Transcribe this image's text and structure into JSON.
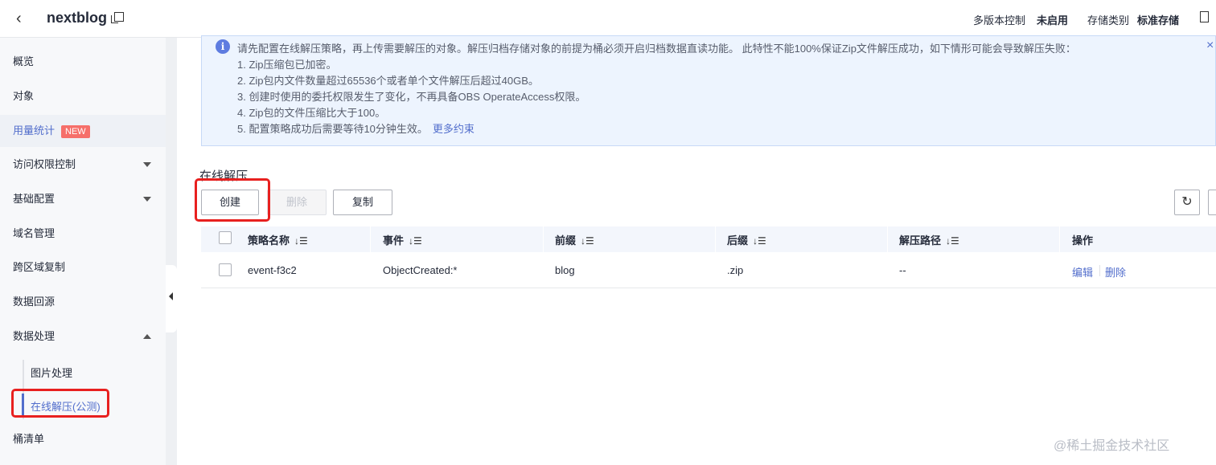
{
  "header": {
    "back_icon": "chevron-left-icon",
    "bucket_name": "nextblog",
    "versioning_label": "多版本控制",
    "versioning_value": "未启用",
    "storage_class_label": "存储类别",
    "storage_class_value": "标准存储"
  },
  "sidebar": {
    "items": [
      {
        "label": "概览"
      },
      {
        "label": "对象"
      },
      {
        "label": "用量统计",
        "badge": "NEW"
      },
      {
        "label": "访问权限控制"
      },
      {
        "label": "基础配置"
      },
      {
        "label": "域名管理"
      },
      {
        "label": "跨区域复制"
      },
      {
        "label": "数据回源"
      },
      {
        "label": "数据处理"
      },
      {
        "label": "桶清单"
      }
    ],
    "sub_items": [
      {
        "label": "图片处理"
      },
      {
        "label": "在线解压(公测)"
      }
    ]
  },
  "notice": {
    "line1": "请先配置在线解压策略，再上传需要解压的对象。解压归档存储对象的前提为桶必须开启归档数据直读功能。 此特性不能100%保证Zip文件解压成功，如下情形可能会导致解压失败：",
    "items": [
      "1. Zip压缩包已加密。",
      "2. Zip包内文件数量超过65536个或者单个文件解压后超过40GB。",
      "3. 创建时使用的委托权限发生了变化，不再具备OBS OperateAccess权限。",
      "4. Zip包的文件压缩比大于100。",
      "5. 配置策略成功后需要等待10分钟生效。"
    ],
    "more_link": "更多约束",
    "close": "×"
  },
  "main": {
    "title": "在线解压",
    "create_label": "创建",
    "delete_label": "删除",
    "copy_label": "复制",
    "refresh_icon": "refresh-icon"
  },
  "table": {
    "columns": [
      "策略名称",
      "事件",
      "前缀",
      "后缀",
      "解压路径",
      "操作"
    ],
    "sort_glyph": "↓☰",
    "rows": [
      {
        "name": "event-f3c2",
        "event": "ObjectCreated:*",
        "prefix": "blog",
        "suffix": ".zip",
        "path": "--",
        "edit": "编辑",
        "delete": "删除"
      }
    ]
  },
  "watermark": "@稀土掘金技术社区",
  "colors": {
    "accent": "#526ecc",
    "highlight_box": "#e8201f",
    "notice_bg": "#edf4fe",
    "new_badge": "#f66f6a"
  }
}
